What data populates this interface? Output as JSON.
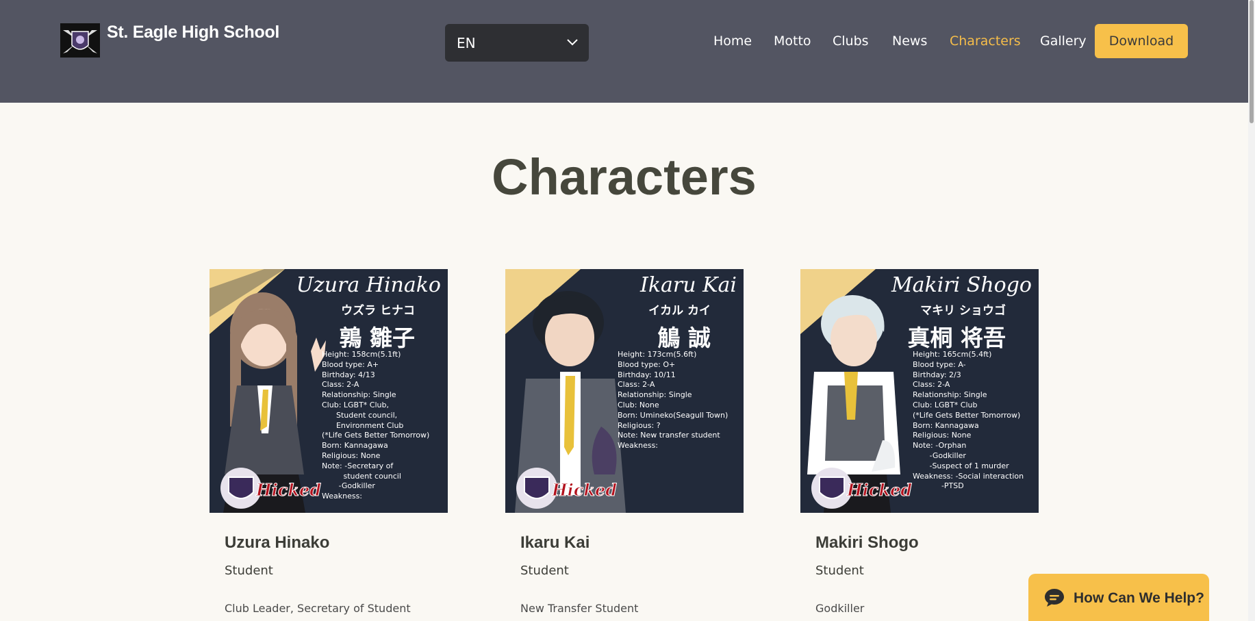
{
  "header": {
    "site_title": "St. Eagle High School",
    "language": "EN",
    "nav": [
      "Home",
      "Motto",
      "Clubs",
      "News",
      "Characters",
      "Gallery"
    ],
    "active_nav": "Characters",
    "download_label": "Download"
  },
  "colors": {
    "header_bg": "#535562",
    "accent": "#f7c04a",
    "active_link": "#f5bd4a",
    "page_bg": "#faf8f3"
  },
  "page_title": "Characters",
  "characters": [
    {
      "name": "Uzura Hinako",
      "role": "Student",
      "description": "Club Leader, Secretary of Student",
      "image": {
        "name": "Uzura Hinako",
        "kana": "ウズラ ヒナコ",
        "kanji": "鶉 雛子",
        "stats": "Height: 158cm(5.1ft)\nBlood type: A+\nBirthday: 4/13\nClass: 2-A\nRelationship: Single\nClub: LGBT* Club,\n      Student council,\n      Environment Club\n(*Life Gets Better Tomorrow)\nBorn: Kannagawa\nReligious: None\nNote: -Secretary of\n         student council\n       -Godkiller\nWeakness:",
        "brand": "Hicked"
      }
    },
    {
      "name": "Ikaru Kai",
      "role": "Student",
      "description": "New Transfer Student",
      "image": {
        "name": "Ikaru Kai",
        "kana": "イカル カイ",
        "kanji": "鵤 誠",
        "stats": "Height: 173cm(5.6ft)\nBlood type: O+\nBirthday: 10/11\nClass: 2-A\nRelationship: Single\nClub: None\nBorn: Umineko(Seagull Town)\nReligious: ?\nNote: New transfer student\nWeakness:",
        "brand": "Hicked"
      }
    },
    {
      "name": "Makiri Shogo",
      "role": "Student",
      "description": "Godkiller",
      "image": {
        "name": "Makiri Shogo",
        "kana": "マキリ  ショウゴ",
        "kanji": "真桐 将吾",
        "stats": "Height: 165cm(5.4ft)\nBlood type: A-\nBirthday: 2/3\nClass: 2-A\nRelationship: Single\nClub: LGBT* Club\n(*Life Gets Better Tomorrow)\nBorn: Kannagawa\nReligious: None\nNote: -Orphan\n       -Godkiller\n       -Suspect of 1 murder\nWeakness: -Social interaction\n            -PTSD",
        "brand": "Hicked"
      }
    }
  ],
  "chat": {
    "label": "How Can We Help?"
  }
}
